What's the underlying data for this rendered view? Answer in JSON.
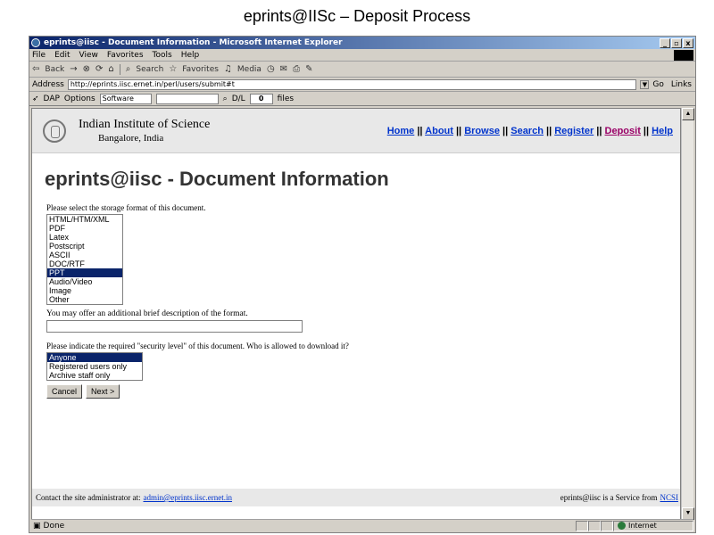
{
  "slide_title": "eprints@IISc – Deposit Process",
  "window": {
    "title": "eprints@iisc - Document Information - Microsoft Internet Explorer",
    "controls": [
      "_",
      "▫",
      "x"
    ]
  },
  "menu": [
    "File",
    "Edit",
    "View",
    "Favorites",
    "Tools",
    "Help"
  ],
  "toolbar": {
    "back": "Back",
    "search": "Search",
    "favorites": "Favorites",
    "media": "Media"
  },
  "addressbar": {
    "label": "Address",
    "url": "http://eprints.iisc.ernet.in/perl/users/submit#t",
    "go": "Go",
    "links": "Links"
  },
  "linksbar": {
    "dap": "DAP",
    "options": "Options",
    "software": "Software",
    "dl": "D/L",
    "count": "0",
    "files": "files"
  },
  "site": {
    "institute_name": "Indian Institute of Science",
    "institute_location": "Bangalore, India",
    "nav": [
      "Home",
      "About",
      "Browse",
      "Search",
      "Register",
      "Deposit",
      "Help"
    ],
    "separator": " || "
  },
  "page": {
    "heading": "eprints@iisc - Document Information",
    "format_label": "Please select the storage format of this document.",
    "formats": [
      "HTML/HTM/XML",
      "PDF",
      "Latex",
      "Postscript",
      "ASCII",
      "DOC/RTF",
      "PPT",
      "Audio/Video",
      "Image",
      "Other"
    ],
    "selected_format": "PPT",
    "description_label": "You may offer an additional brief description of the format.",
    "description_value": "",
    "security_label": "Please indicate the required \"security level\" of this document. Who is allowed to download it?",
    "security_levels": [
      "Anyone",
      "Registered users only",
      "Archive staff only"
    ],
    "selected_security": "Anyone",
    "cancel_label": "Cancel",
    "next_label": "Next >"
  },
  "footer": {
    "contact_text": "Contact the site administrator at: ",
    "admin_email": "admin@eprints.iisc.ernet.in",
    "service_text": "eprints@iisc is a Service from ",
    "service_link": "NCSI"
  },
  "status": {
    "text": "Done",
    "zone": "Internet"
  }
}
